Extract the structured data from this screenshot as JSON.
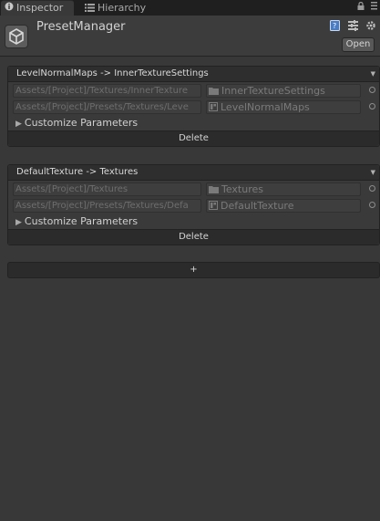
{
  "tabs": [
    {
      "label": "Inspector",
      "icon": "info-icon"
    },
    {
      "label": "Hierarchy",
      "icon": "list-icon"
    }
  ],
  "header": {
    "title": "PresetManager",
    "open_label": "Open"
  },
  "presets": [
    {
      "header": "LevelNormalMaps -> InnerTextureSettings",
      "target_path": "Assets/[Project]/Textures/InnerTexture",
      "target_object": "InnerTextureSettings",
      "target_icon": "folder-icon",
      "preset_path": "Assets/[Project]/Presets/Textures/Leve",
      "preset_object": "LevelNormalMaps",
      "preset_icon": "preset-icon",
      "customize_label": "Customize Parameters",
      "delete_label": "Delete"
    },
    {
      "header": "DefaultTexture -> Textures",
      "target_path": "Assets/[Project]/Textures",
      "target_object": "Textures",
      "target_icon": "folder-icon",
      "preset_path": "Assets/[Project]/Presets/Textures/Defa",
      "preset_object": "DefaultTexture",
      "preset_icon": "preset-icon",
      "customize_label": "Customize Parameters",
      "delete_label": "Delete"
    }
  ],
  "add_label": "+",
  "colors": {
    "background": "#383838",
    "tab_bar": "#1f1f1f",
    "header_bg": "#2e2e2e",
    "button_bg": "#2b2b2b"
  }
}
